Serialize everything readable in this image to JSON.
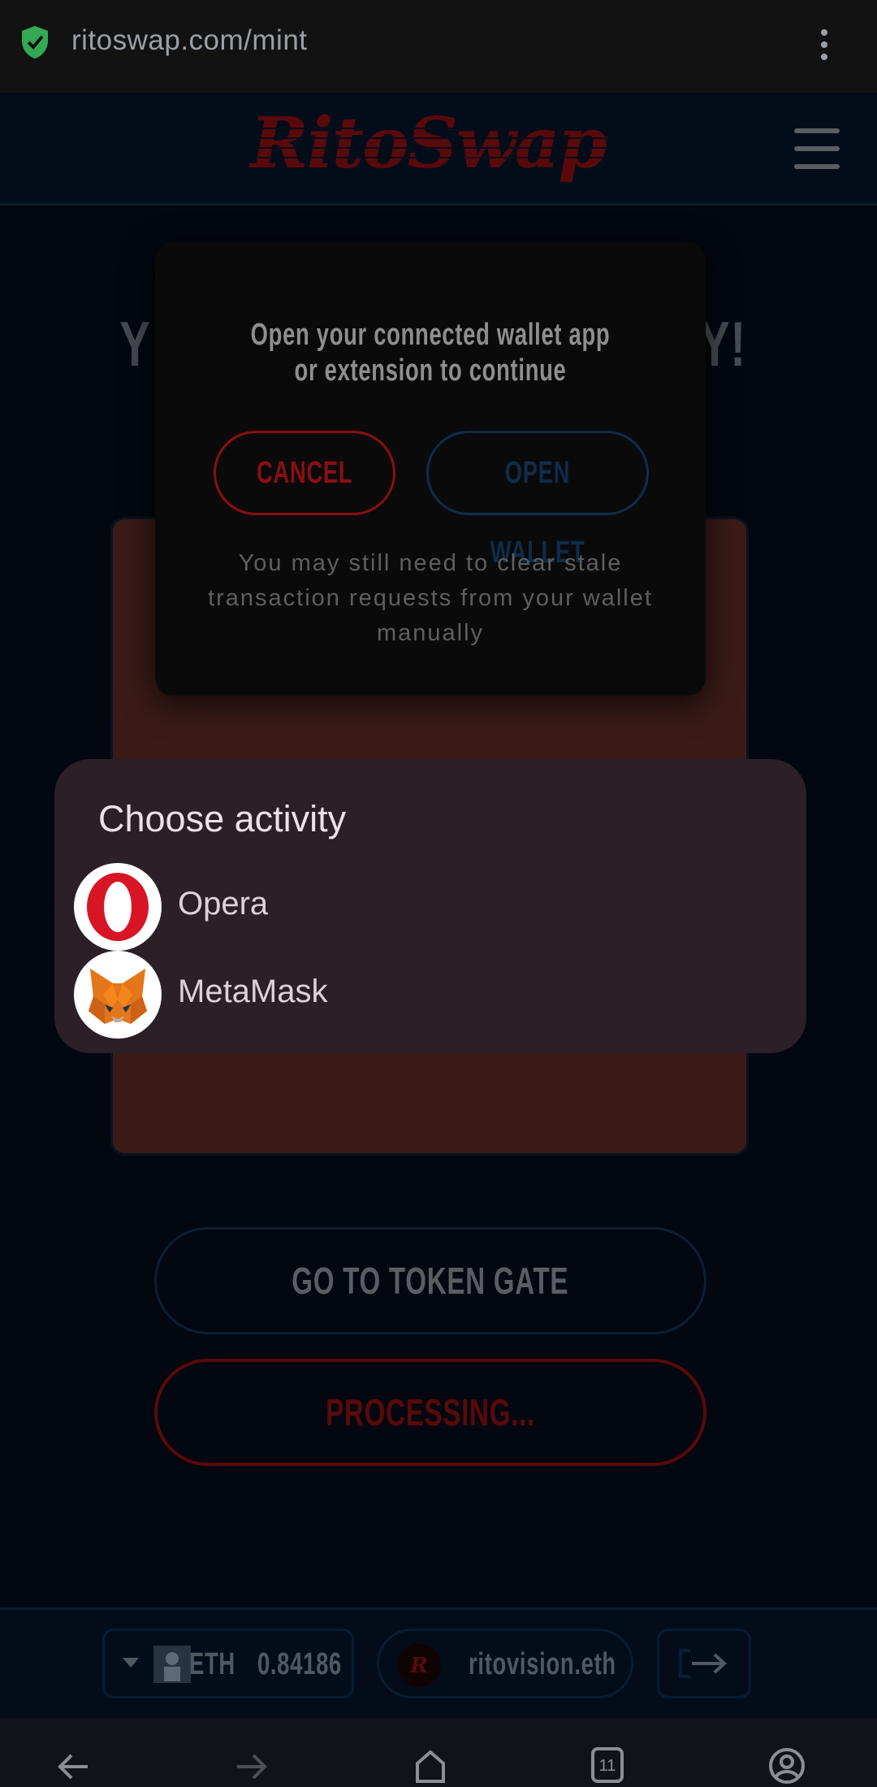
{
  "browser": {
    "url": "ritoswap.com/mint",
    "tab_count": "11"
  },
  "site": {
    "logo_text": "RitoSwap",
    "title_partial_left": "Y",
    "title_partial_right": "Y!"
  },
  "buttons": {
    "token_gate": "GO TO TOKEN GATE",
    "processing": "PROCESSING..."
  },
  "wallet_bar": {
    "network_symbol": "ETH",
    "balance": "0.84186",
    "ens_name": "ritovision.eth"
  },
  "modal": {
    "message": "Open your connected wallet app or extension to continue",
    "cancel_label": "CANCEL",
    "open_wallet_label": "OPEN WALLET",
    "note": "You may still need to clear stale transaction requests from your wallet manually"
  },
  "chooser": {
    "title": "Choose activity",
    "apps": [
      {
        "label": "Opera",
        "icon": "opera-icon"
      },
      {
        "label": "MetaMask",
        "icon": "metamask-icon"
      }
    ]
  },
  "colors": {
    "brand_red": "#8b0f12",
    "background": "#050c17",
    "card": "#5a2a26",
    "sheet": "#2b2028"
  }
}
